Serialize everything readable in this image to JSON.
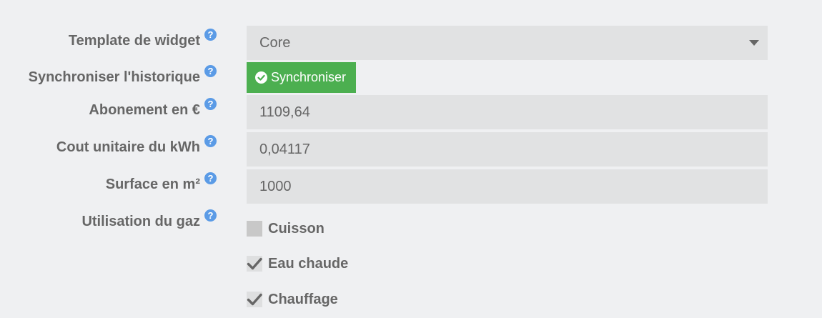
{
  "labels": {
    "widget_template": "Template de widget",
    "sync_history": "Synchroniser l'historique",
    "subscription": "Abonement en €",
    "unit_cost": "Cout unitaire du kWh",
    "surface": "Surface en m²",
    "gas_usage": "Utilisation du gaz"
  },
  "help_glyph": "?",
  "template_select": {
    "value": "Core"
  },
  "sync_button": {
    "label": "Synchroniser",
    "icon": "check-circle-icon",
    "color": "#4caf50"
  },
  "fields": {
    "subscription": "1109,64",
    "unit_cost": "0,04117",
    "surface": "1000"
  },
  "gas_options": [
    {
      "label": "Cuisson",
      "checked": false
    },
    {
      "label": "Eau chaude",
      "checked": true
    },
    {
      "label": "Chauffage",
      "checked": true
    }
  ],
  "colors": {
    "help": "#5b9be6",
    "background": "#eff0f2",
    "field": "#e1e2e3"
  }
}
